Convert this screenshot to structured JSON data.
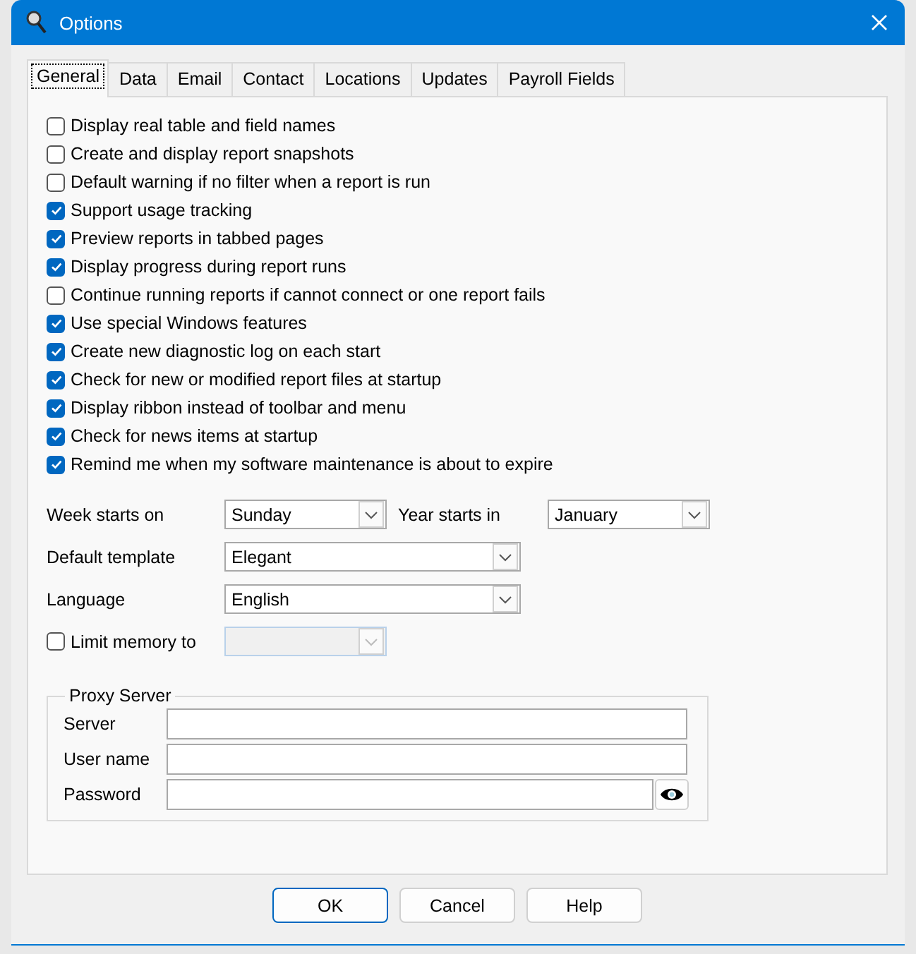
{
  "window": {
    "title": "Options"
  },
  "tabs": [
    {
      "label": "General",
      "selected": true
    },
    {
      "label": "Data",
      "selected": false
    },
    {
      "label": "Email",
      "selected": false
    },
    {
      "label": "Contact",
      "selected": false
    },
    {
      "label": "Locations",
      "selected": false
    },
    {
      "label": "Updates",
      "selected": false
    },
    {
      "label": "Payroll Fields",
      "selected": false
    }
  ],
  "options": [
    {
      "label": "Display real table and field names",
      "checked": false
    },
    {
      "label": "Create and display report snapshots",
      "checked": false
    },
    {
      "label": "Default warning if no filter when a report is run",
      "checked": false
    },
    {
      "label": "Support usage tracking",
      "checked": true
    },
    {
      "label": "Preview reports in tabbed pages",
      "checked": true
    },
    {
      "label": "Display progress during report runs",
      "checked": true
    },
    {
      "label": "Continue running reports if cannot connect or one report fails",
      "checked": false
    },
    {
      "label": "Use special Windows features",
      "checked": true
    },
    {
      "label": "Create new diagnostic log on each start",
      "checked": true
    },
    {
      "label": "Check for new or modified report files at startup",
      "checked": true
    },
    {
      "label": "Display ribbon instead of toolbar and menu",
      "checked": true
    },
    {
      "label": "Check for news items at startup",
      "checked": true
    },
    {
      "label": "Remind me when my software maintenance is about to expire",
      "checked": true
    }
  ],
  "week_starts_on": {
    "label": "Week starts on",
    "value": "Sunday"
  },
  "year_starts_in": {
    "label": "Year starts in",
    "value": "January"
  },
  "default_template": {
    "label": "Default template",
    "value": "Elegant"
  },
  "language": {
    "label": "Language",
    "value": "English"
  },
  "limit_memory": {
    "label": "Limit memory to",
    "checked": false,
    "disabled": true
  },
  "proxy_server": {
    "title": "Proxy Server",
    "fields": [
      {
        "label": "Server"
      },
      {
        "label": "User name"
      },
      {
        "label": "Password",
        "kind": "password"
      }
    ]
  },
  "buttons": [
    {
      "label": "OK",
      "default": true
    },
    {
      "label": "Cancel",
      "default": false
    },
    {
      "label": "Help",
      "default": false
    }
  ]
}
